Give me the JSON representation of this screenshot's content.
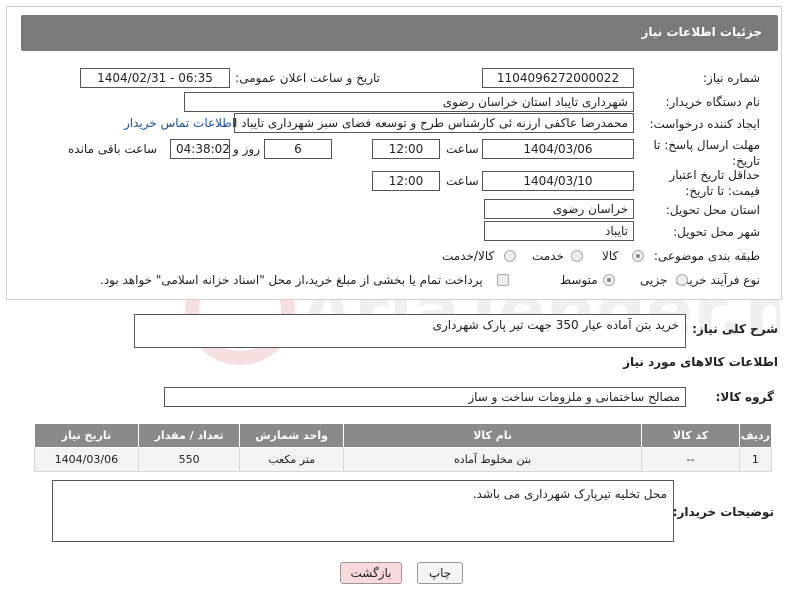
{
  "header": {
    "title": "جزئیات اطلاعات نیاز"
  },
  "fields": {
    "need_number_label": "شماره نیاز:",
    "need_number": "1104096272000022",
    "announce_label": "تاریخ و ساعت اعلان عمومی:",
    "announce_value": "1404/02/31 - 06:35",
    "buyer_org_label": "نام دستگاه خریدار:",
    "buyer_org": "شهرداری تایباد استان خراسان رضوی",
    "creator_label": "ایجاد کننده درخواست:",
    "creator": "محمدرضا عاکفی ارزنه ئی کارشناس طرح و توسعه فضای سبز شهرداری تایباد ات",
    "contact_link": "اطلاعات تماس خریدار",
    "deadline_label": "مهلت ارسال پاسخ: تا تاریخ:",
    "deadline_date": "1404/03/06",
    "time_label": "ساعت",
    "deadline_time": "12:00",
    "days": "6",
    "days_label": "روز و",
    "remaining_time": "04:38:02",
    "remaining_label": "ساعت باقی مانده",
    "price_valid_label": "حداقل تاریخ اعتبار قیمت: تا تاریخ:",
    "price_valid_date": "1404/03/10",
    "price_valid_time_label": "ساعت",
    "price_valid_time": "12:00",
    "province_label": "استان محل تحویل:",
    "province": "خراسان رضوی",
    "city_label": "شهر محل تحویل:",
    "city": "تایباد",
    "category_label": "طبقه بندی موضوعی:",
    "category_options": [
      "کالا",
      "خدمت",
      "کالا/خدمت"
    ],
    "process_label": "نوع فرآیند خرید :",
    "process_options": [
      "جزیی",
      "متوسط"
    ],
    "payment_note": "پرداخت تمام یا بخشی از مبلغ خرید،از محل \"اسناد خزانه اسلامی\" خواهد بود."
  },
  "summary": {
    "label": "شرح کلی نیاز:",
    "text": "خرید بتن آماده عیار 350 جهت تیر پارک شهرداری"
  },
  "goods_info_title": "اطلاعات کالاهای مورد نیاز",
  "goods_group": {
    "label": "گروه کالا:",
    "value": "مصالح ساختمانی و ملزومات ساخت و ساز"
  },
  "table": {
    "headers": [
      "ردیف",
      "کد کالا",
      "نام کالا",
      "واحد شمارش",
      "تعداد / مقدار",
      "تاریخ نیاز"
    ],
    "rows": [
      [
        "1",
        "--",
        "بتن مخلوط آماده",
        "متر مکعب",
        "550",
        "1404/03/06"
      ]
    ]
  },
  "buyer_notes": {
    "label": "توضیحات خریدار:",
    "text": "محل تخلیه تیرپارک شهرداری می باشد."
  },
  "buttons": {
    "print": "چاپ",
    "back": "بازگشت"
  },
  "watermark_text": "AriaTender.neT",
  "colors": {
    "header_bg": "#7a7a7a",
    "link": "#1a4fa0",
    "back_btn": "#f9d9dc"
  }
}
